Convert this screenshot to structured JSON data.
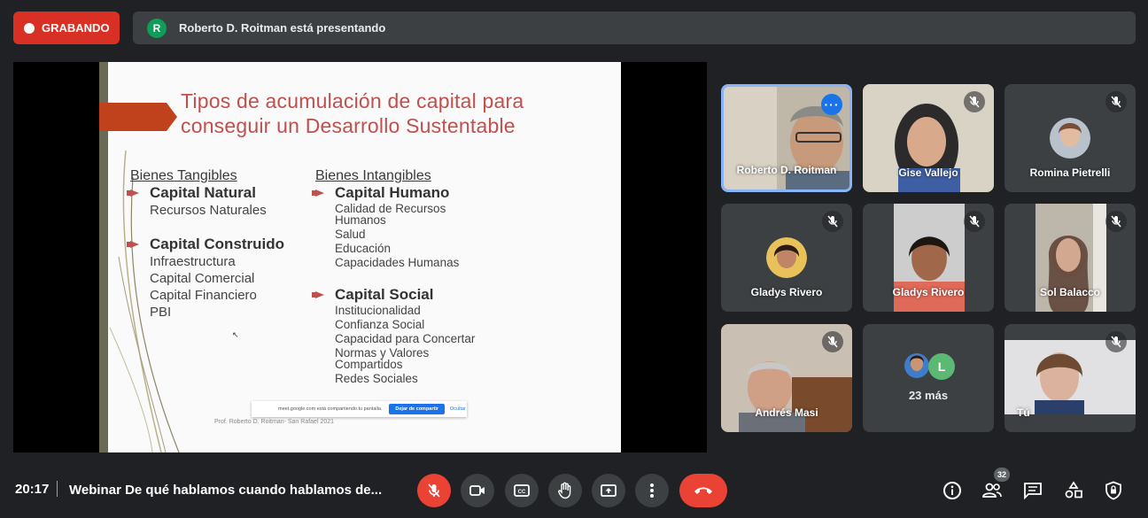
{
  "recording": {
    "label": "GRABANDO"
  },
  "presenter": {
    "avatar_letter": "R",
    "text": "Roberto D. Roitman está presentando"
  },
  "slide": {
    "title_line1": "Tipos de acumulación de capital para",
    "title_line2": "conseguir un Desarrollo Sustentable",
    "left_heading": "Bienes Tangibles",
    "left_items": [
      {
        "title": "Capital Natural",
        "subs": [
          "Recursos Naturales"
        ]
      },
      {
        "title": "Capital Construido",
        "subs": [
          "Infraestructura",
          "Capital Comercial",
          "Capital Financiero",
          "PBI"
        ]
      }
    ],
    "right_heading": "Bienes Intangibles",
    "right_items": [
      {
        "title": "Capital Humano",
        "subs": [
          "Calidad de Recursos",
          "Humanos",
          "Salud",
          "Educación",
          "Capacidades Humanas"
        ]
      },
      {
        "title": "Capital Social",
        "subs": [
          "Institucionalidad",
          "Confianza Social",
          "Capacidad para Concertar",
          "Normas y Valores",
          "Compartidos",
          "Redes Sociales"
        ]
      }
    ],
    "credit": "Prof. Roberto D. Roitman- San Rafael 2021",
    "share_popup": {
      "text": "meet.google.com está compartiendo tu pantalla.",
      "stop_label": "Dejar de compartir",
      "hide_label": "Ocultar"
    }
  },
  "participants": [
    {
      "name": "Roberto D. Roitman",
      "active": true
    },
    {
      "name": "Gise Vallejo"
    },
    {
      "name": "Romina Pietrelli"
    },
    {
      "name": "Gladys Rivero"
    },
    {
      "name": "Gladys Rivero"
    },
    {
      "name": "Sol Balacco"
    },
    {
      "name": "Andrés Masi"
    },
    {
      "name": "23 más",
      "extra_letter": "L"
    },
    {
      "name": "Tú"
    }
  ],
  "bottom": {
    "time": "20:17",
    "meeting_title": "Webinar De qué hablamos cuando hablamos de...",
    "participants_count": "32"
  },
  "colors": {
    "accent_red": "#ea4335",
    "bar_bg": "#3c4043",
    "bg": "#202124",
    "slide_red": "#c0504d"
  }
}
